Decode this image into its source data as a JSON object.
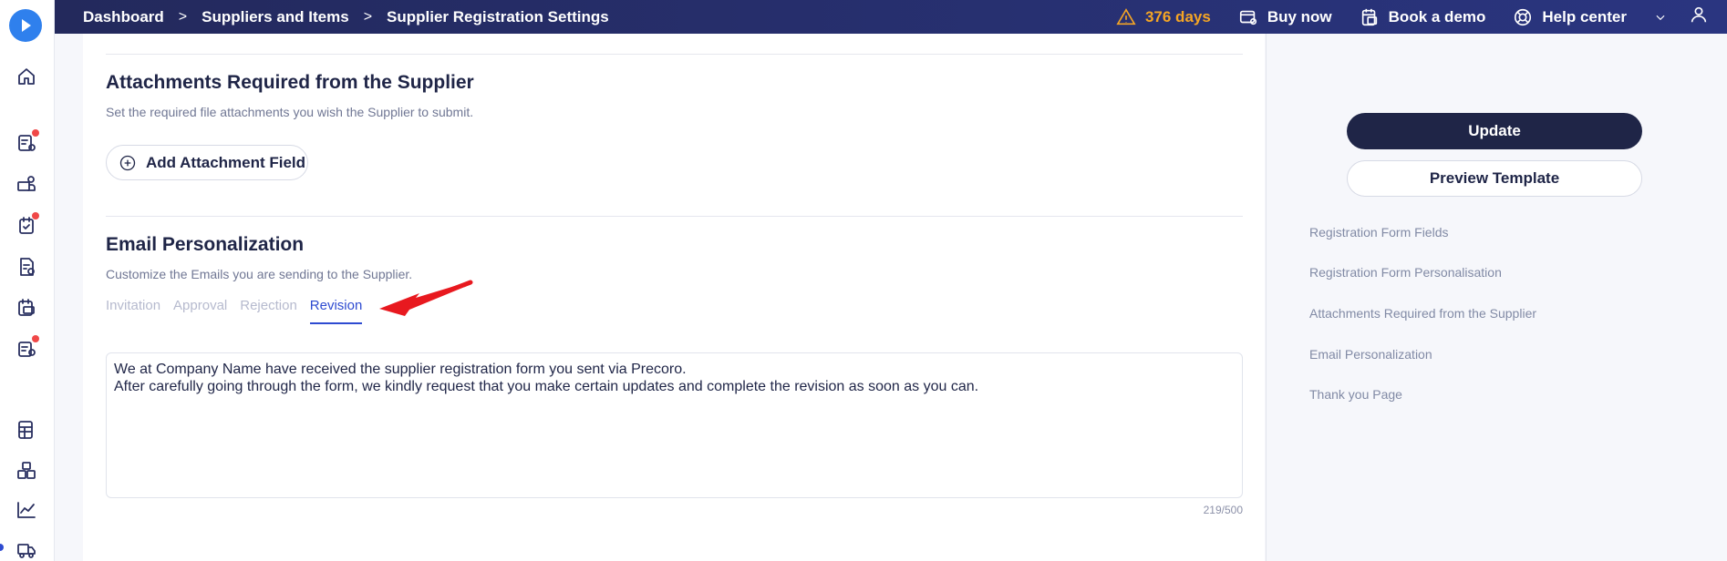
{
  "breadcrumb": {
    "items": [
      "Dashboard",
      "Suppliers and Items",
      "Supplier Registration Settings"
    ],
    "separator": ">"
  },
  "topbar": {
    "trial": "376 days",
    "buy_now": "Buy now",
    "book_demo": "Book a demo",
    "help_center": "Help center"
  },
  "attachments": {
    "title": "Attachments Required from the Supplier",
    "description": "Set the required file attachments you wish the Supplier to submit.",
    "add_button": "Add Attachment Field"
  },
  "email": {
    "title": "Email Personalization",
    "description": "Customize the Emails you are sending to the Supplier.",
    "tabs": [
      "Invitation",
      "Approval",
      "Rejection",
      "Revision"
    ],
    "active_tab": "Revision",
    "body": "We at Company Name have received the supplier registration form you sent via Precoro.\nAfter carefully going through the form, we kindly request that you make certain updates and complete the revision as soon as you can.",
    "counter": "219/500"
  },
  "actions": {
    "update": "Update",
    "preview": "Preview Template"
  },
  "page_nav": [
    "Registration Form Fields",
    "Registration Form Personalisation",
    "Attachments Required from the Supplier",
    "Email Personalization",
    "Thank you Page"
  ],
  "colors": {
    "accent": "#2e4bd1",
    "topbar": "#23295c",
    "warning": "#f5a524",
    "annotation_arrow": "#e8191f"
  }
}
